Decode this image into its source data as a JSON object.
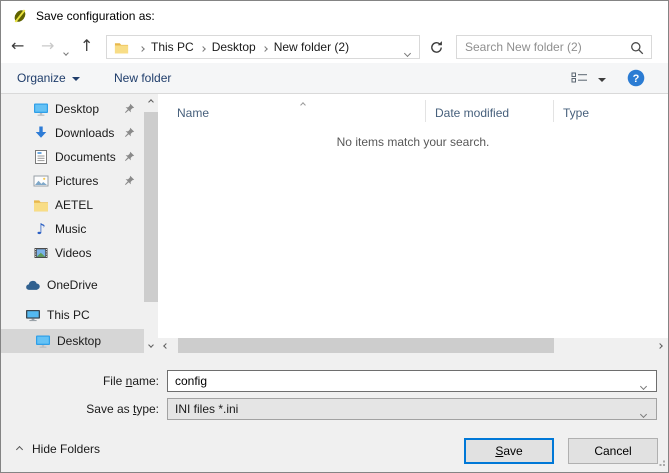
{
  "titlebar": {
    "title": "Save configuration as:"
  },
  "navbar": {
    "breadcrumb": [
      "This PC",
      "Desktop",
      "New folder (2)"
    ],
    "search_placeholder": "Search New folder (2)"
  },
  "toolbar": {
    "organize": "Organize",
    "new_folder": "New folder"
  },
  "sidebar": [
    {
      "label": "Desktop"
    },
    {
      "label": "Downloads"
    },
    {
      "label": "Documents"
    },
    {
      "label": "Pictures"
    },
    {
      "label": "AETEL"
    },
    {
      "label": "Music"
    },
    {
      "label": "Videos"
    },
    {
      "label": "OneDrive"
    },
    {
      "label": "This PC"
    },
    {
      "label": "Desktop"
    }
  ],
  "filelist": {
    "columns": [
      "Name",
      "Date modified",
      "Type"
    ],
    "empty_message": "No items match your search."
  },
  "form": {
    "file_name_label": {
      "pre": "File ",
      "mnemonic": "n",
      "post": "ame:"
    },
    "file_name_value": "config",
    "save_as_type_label": {
      "pre": "Save as ",
      "mnemonic": "t",
      "post": "ype:"
    },
    "save_as_type_value": "INI files *.ini"
  },
  "footer": {
    "hide_folders": "Hide Folders",
    "save": {
      "mnemonic": "S",
      "post": "ave"
    },
    "cancel": "Cancel"
  },
  "colors": {
    "accent_blue": "#0078d7",
    "toolbar_text": "#1f3d6b",
    "header_text": "#47607c"
  }
}
